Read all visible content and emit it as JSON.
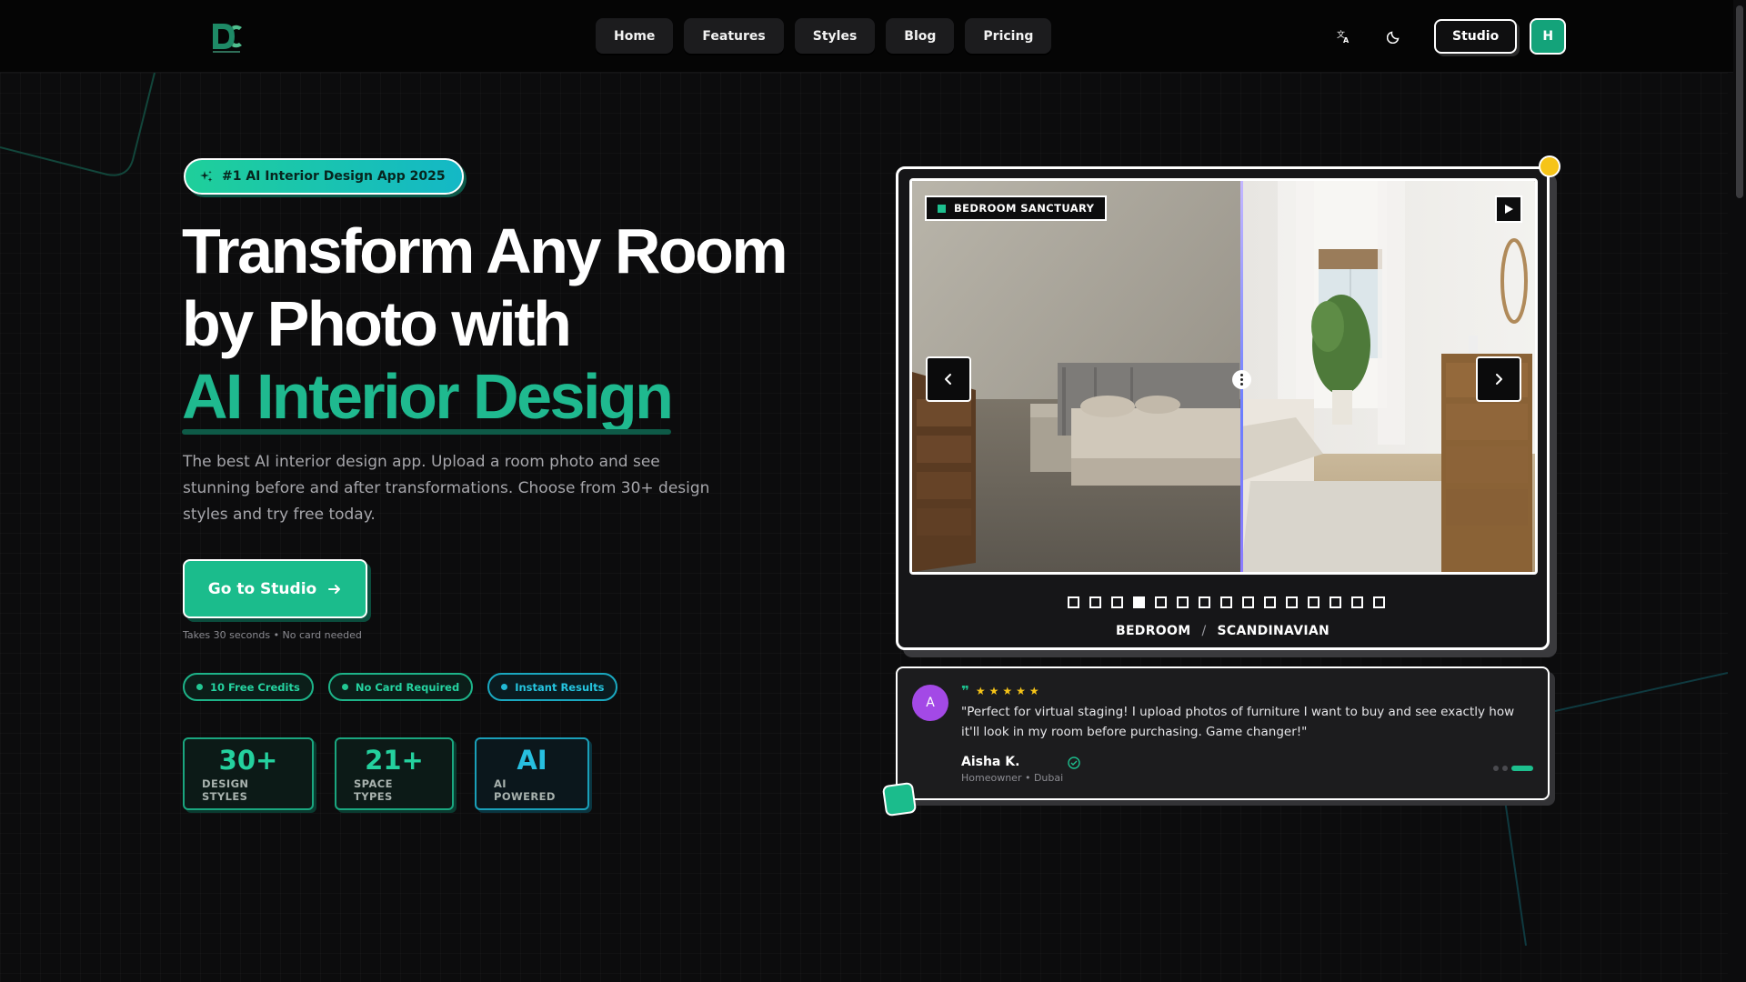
{
  "nav": {
    "logo_alt": "DC",
    "links": [
      "Home",
      "Features",
      "Styles",
      "Blog",
      "Pricing"
    ],
    "studio_label": "Studio",
    "avatar_initial": "H"
  },
  "hero": {
    "badge": "#1 AI Interior Design App 2025",
    "headline_line1": "Transform Any Room",
    "headline_line2": "by Photo with",
    "headline_accent": "AI Interior Design",
    "subtext": "The best AI interior design app. Upload a room photo and see stunning before and after transformations. Choose from 30+ design styles and try free today.",
    "cta_label": "Go to Studio",
    "cta_note": "Takes 30 seconds • No card needed",
    "pills": [
      "10 Free Credits",
      "No Card Required",
      "Instant Results"
    ],
    "stats": [
      {
        "value": "30+",
        "label": "DESIGN STYLES"
      },
      {
        "value": "21+",
        "label": "SPACE TYPES"
      },
      {
        "value": "AI",
        "label": "AI POWERED"
      }
    ]
  },
  "showcase": {
    "room_tag": "BEDROOM SANCTUARY",
    "caption_room": "BEDROOM",
    "caption_separator": "/",
    "caption_style": "SCANDINAVIAN",
    "slide_count": 15,
    "active_slide": 4
  },
  "testimonial": {
    "avatar_initial": "A",
    "rating": 5,
    "quote": "\"Perfect for virtual staging! I upload photos of furniture I want to buy and see exactly how it'll look in my room before purchasing. Game changer!\"",
    "name": "Aisha K.",
    "meta": "Homeowner • Dubai",
    "page_count": 3,
    "active_page": 3
  },
  "colors": {
    "accent": "#1bbc8c",
    "accent_cyan": "#14b8c6",
    "background": "#0c0c0d",
    "star": "#f6c418"
  }
}
